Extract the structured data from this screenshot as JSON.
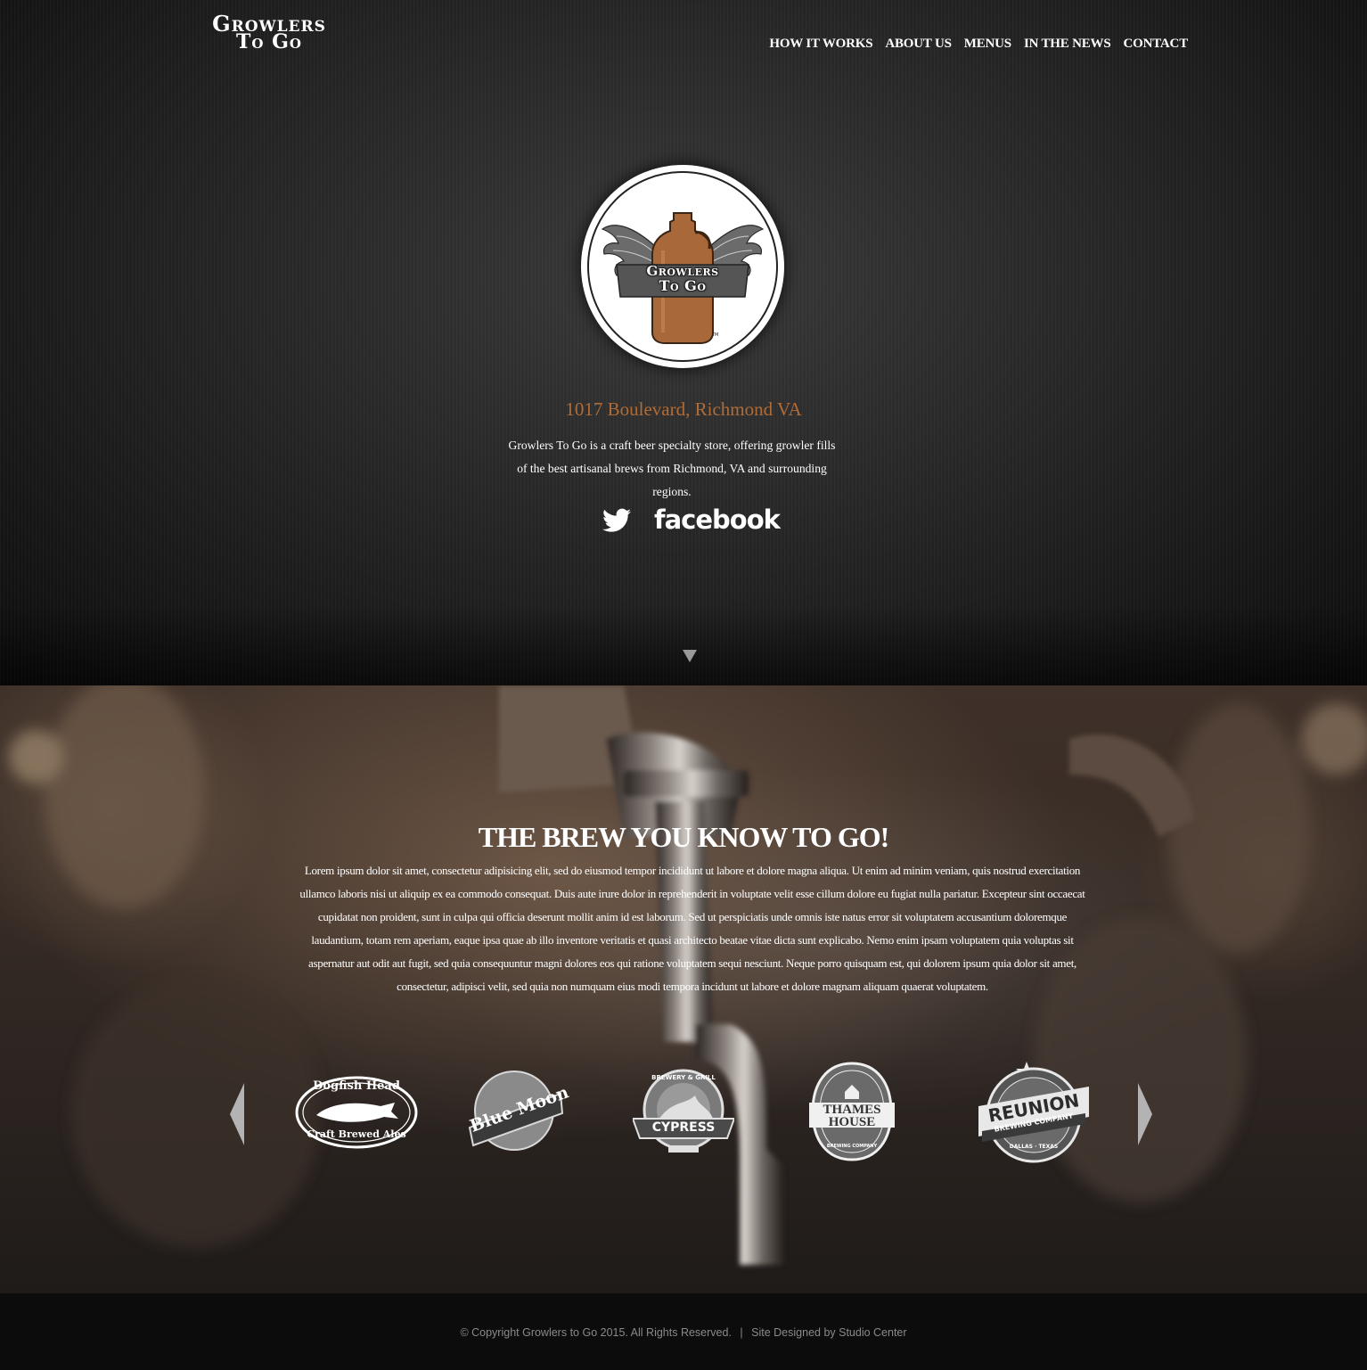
{
  "header": {
    "logo": {
      "line1": "Growlers",
      "line2": "To Go"
    },
    "nav": [
      "HOW IT WORKS",
      "ABOUT US",
      "MENUS",
      "IN THE NEWS",
      "CONTACT"
    ]
  },
  "hero": {
    "badge": {
      "line1": "Growlers",
      "line2": "To Go",
      "tm": "TM"
    },
    "address": "1017 Boulevard, Richmond VA",
    "description": "Growlers To Go is a craft beer specialty store, offering growler fills of the best artisanal brews from Richmond, VA and surrounding regions.",
    "social": {
      "twitter_icon": "twitter-icon",
      "facebook_label": "facebook"
    },
    "scroll_icon": "triangle-down-icon"
  },
  "brew": {
    "title": "THE BREW YOU KNOW TO GO!",
    "body": "Lorem ipsum dolor sit amet, consectetur adipisicing elit, sed do eiusmod tempor incididunt ut labore et dolore magna aliqua. Ut enim ad minim veniam, quis nostrud exercitation ullamco laboris nisi ut aliquip ex ea commodo consequat. Duis aute irure dolor in reprehenderit in voluptate velit esse cillum dolore eu fugiat nulla pariatur. Excepteur sint occaecat cupidatat non proident, sunt in culpa qui officia deserunt mollit anim id est laborum. Sed ut perspiciatis unde omnis iste natus error sit voluptatem accusantium doloremque laudantium, totam rem aperiam, eaque ipsa quae ab illo inventore veritatis et quasi architecto beatae vitae dicta sunt explicabo. Nemo enim ipsam voluptatem quia voluptas sit aspernatur aut odit aut fugit, sed quia consequuntur magni dolores eos qui ratione voluptatem sequi nesciunt. Neque porro quisquam est, qui dolorem ipsum quia dolor sit amet, consectetur, adipisci velit, sed quia non numquam eius modi tempora incidunt ut labore et dolore magnam aliquam quaerat voluptatem.",
    "brands": {
      "dogfish": {
        "top": "Dogfish Head",
        "bottom": "Craft Brewed Ales"
      },
      "bluemoon": {
        "name": "Blue Moon"
      },
      "cypress": {
        "top": "BREWERY & GRILL",
        "name": "CYPRESS"
      },
      "thames": {
        "line1": "THAMES",
        "line2": "HOUSE",
        "sub": "BREWING COMPANY"
      },
      "reunion": {
        "name": "REUNION",
        "sub": "BREWING COMPANY",
        "loc": "DALLAS · TEXAS"
      }
    }
  },
  "footer": {
    "copyright": "© Copyright Growlers to Go 2015. All Rights Reserved.",
    "separator": "|",
    "credit": "Site Designed by Studio Center"
  },
  "colors": {
    "accent": "#b06c37",
    "footer_text": "#8a8a8a",
    "hero_bg": "#262626"
  }
}
